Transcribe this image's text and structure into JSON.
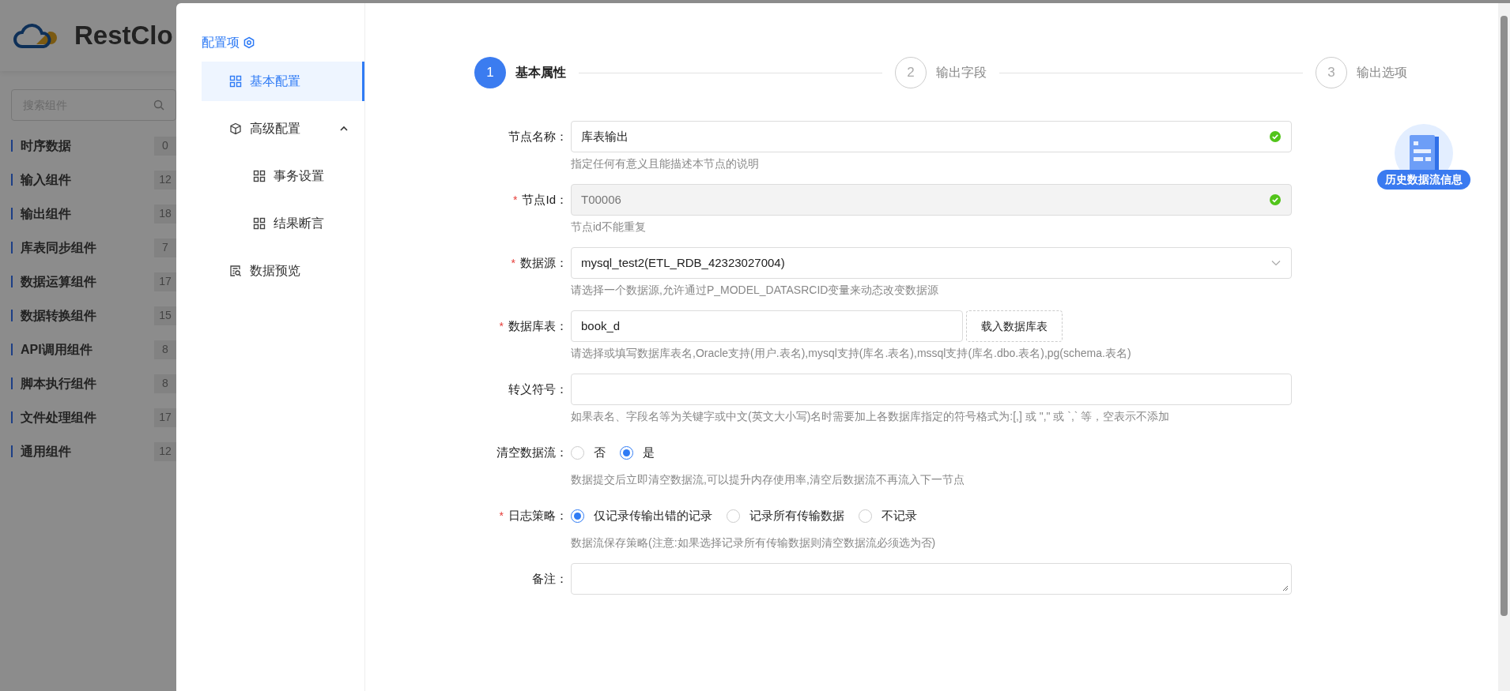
{
  "background_app": {
    "logo_text": "RestClo",
    "search": {
      "placeholder": "搜索组件"
    },
    "categories": [
      {
        "label": "时序数据",
        "count": "0"
      },
      {
        "label": "输入组件",
        "count": "12"
      },
      {
        "label": "输出组件",
        "count": "18"
      },
      {
        "label": "库表同步组件",
        "count": "7"
      },
      {
        "label": "数据运算组件",
        "count": "17"
      },
      {
        "label": "数据转换组件",
        "count": "15"
      },
      {
        "label": "API调用组件",
        "count": "8"
      },
      {
        "label": "脚本执行组件",
        "count": "8"
      },
      {
        "label": "文件处理组件",
        "count": "17"
      },
      {
        "label": "通用组件",
        "count": "12"
      }
    ]
  },
  "drawer": {
    "nav": {
      "title": "配置项",
      "items": [
        {
          "kind": "grid",
          "label": "基本配置",
          "selected": true
        },
        {
          "kind": "cube",
          "label": "高级配置",
          "selected": false,
          "expanded": true,
          "children": [
            {
              "kind": "grid",
              "label": "事务设置",
              "selected": false
            },
            {
              "kind": "grid",
              "label": "结果断言",
              "selected": false
            }
          ]
        },
        {
          "kind": "preview",
          "label": "数据预览",
          "selected": false
        }
      ]
    },
    "steps": [
      {
        "number": "1",
        "label": "基本属性",
        "selected": true
      },
      {
        "number": "2",
        "label": "输出字段",
        "selected": false
      },
      {
        "number": "3",
        "label": "输出选项",
        "selected": false
      }
    ],
    "form": {
      "fields": [
        {
          "kind": "text",
          "label": "节点名称：",
          "value": "库表输出",
          "valid": true,
          "disabled": false,
          "help": "指定任何有意义且能描述本节点的说明"
        },
        {
          "kind": "text",
          "label": "节点Id：",
          "required_mark": "*",
          "value": "T00006",
          "valid": true,
          "disabled": true,
          "help": "节点id不能重复"
        },
        {
          "kind": "select",
          "label": "数据源：",
          "required_mark": "*",
          "value": "mysql_test2(ETL_RDB_42323027004)",
          "help": "请选择一个数据源,允许通过P_MODEL_DATASRCID变量来动态改变数据源"
        },
        {
          "kind": "text_button",
          "label": "数据库表：",
          "required_mark": "*",
          "value": "book_d",
          "button": "载入数据库表",
          "help": "请选择或填写数据库表名,Oracle支持(用户.表名),mysql支持(库名.表名),mssql支持(库名.dbo.表名),pg(schema.表名)"
        },
        {
          "kind": "text",
          "label": "转义符号：",
          "valid": false,
          "disabled": false,
          "help": "如果表名、字段名等为关键字或中文(英文大小写)名时需要加上各数据库指定的符号格式为:[,] 或 \",\" 或 `,` 等，空表示不添加"
        },
        {
          "kind": "radio",
          "label": "清空数据流：",
          "options": [
            {
              "label": "否",
              "selected": false
            },
            {
              "label": "是",
              "selected": true
            }
          ],
          "help": "数据提交后立即清空数据流,可以提升内存使用率,清空后数据流不再流入下一节点"
        },
        {
          "kind": "radio",
          "label": "日志策略：",
          "required_mark": "*",
          "options": [
            {
              "label": "仅记录传输出错的记录",
              "selected": true
            },
            {
              "label": "记录所有传输数据",
              "selected": false
            },
            {
              "label": "不记录",
              "selected": false
            }
          ],
          "help": "数据流保存策略(注意:如果选择记录所有传输数据则清空数据流必须选为否)"
        },
        {
          "kind": "textarea",
          "label": "备注："
        }
      ]
    },
    "history_button": {
      "label": "历史数据流信息"
    }
  }
}
